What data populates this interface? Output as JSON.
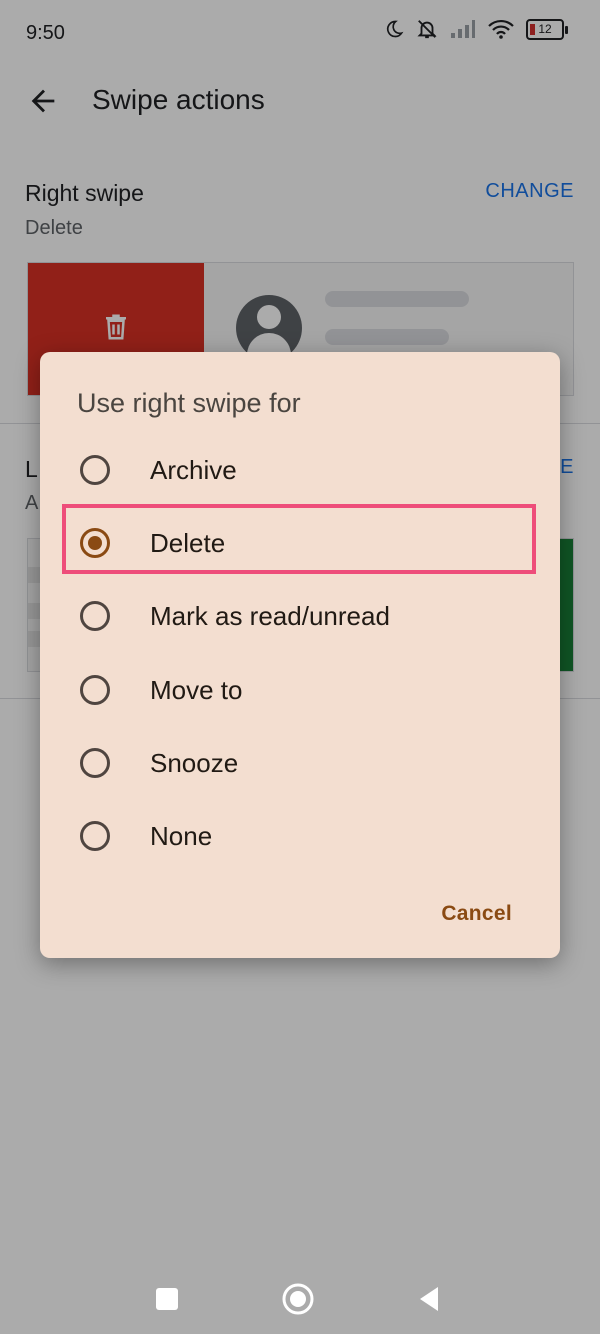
{
  "status_bar": {
    "time": "9:50",
    "battery": "12",
    "icons": [
      "moon-icon",
      "silent-alarm-icon",
      "signal-icon",
      "wifi-icon",
      "battery-icon"
    ]
  },
  "app_bar": {
    "title": "Swipe actions",
    "back_icon": "back-arrow-icon"
  },
  "right_swipe": {
    "title": "Right swipe",
    "value": "Delete",
    "change_label": "CHANGE",
    "preview_icon": "trash-icon"
  },
  "left_swipe": {
    "title_visible": "L",
    "value_visible": "A",
    "change_visible": "E"
  },
  "dialog": {
    "title": "Use right swipe for",
    "options": [
      {
        "label": "Archive",
        "selected": false
      },
      {
        "label": "Delete",
        "selected": true
      },
      {
        "label": "Mark as read/unread",
        "selected": false
      },
      {
        "label": "Move to",
        "selected": false
      },
      {
        "label": "Snooze",
        "selected": false
      },
      {
        "label": "None",
        "selected": false
      }
    ],
    "cancel_label": "Cancel"
  },
  "nav_bar": {
    "icons": [
      "recents-square-icon",
      "home-circle-icon",
      "back-triangle-icon"
    ]
  },
  "colors": {
    "accent": "#1a73e8",
    "delete_red": "#d93025",
    "archive_green": "#188038",
    "dialog_bg": "#f3ded0",
    "radio_brown": "#8a4a13",
    "highlight": "#ee4d7a"
  }
}
